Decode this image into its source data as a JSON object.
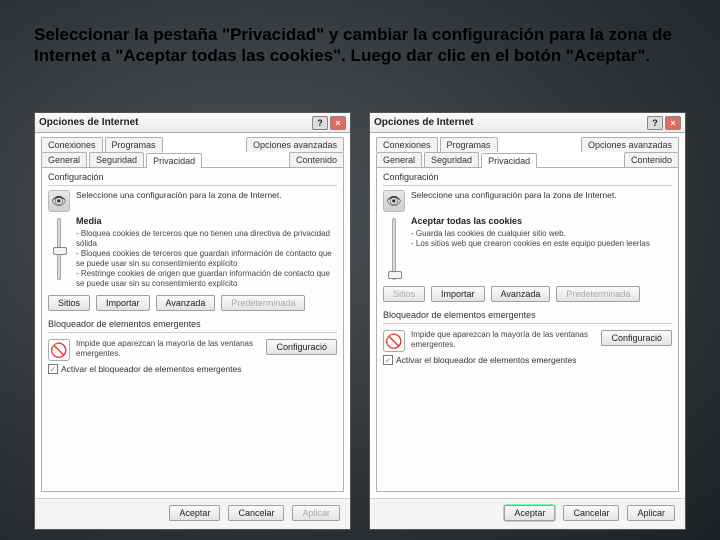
{
  "instruction": "Seleccionar la pestaña \"Privacidad\" y cambiar la configuración para la zona de Internet a \"Aceptar todas las cookies\". Luego dar clic en el botón \"Aceptar\".",
  "window_title": "Opciones de Internet",
  "tabs_row1": [
    "Conexiones",
    "Programas",
    "Opciones avanzadas"
  ],
  "tabs_row2": [
    "General",
    "Seguridad",
    "Privacidad",
    "Contenido"
  ],
  "active_tab": "Privacidad",
  "group_config": "Configuración",
  "config_text": "Seleccione una configuración para la zona de Internet.",
  "left": {
    "level_title": "Media",
    "level_desc": "- Bloquea cookies de terceros que no tienen una directiva de privacidad sólida\n- Bloquea cookies de terceros que guardan información de contacto que se puede usar sin su consentimiento explícito\n- Restringe cookies de origen que guardan información de contacto que se puede usar sin su consentimiento explícito"
  },
  "right": {
    "level_title": "Aceptar todas las cookies",
    "level_desc": "- Guarda las cookies de cualquier sitio web.\n- Los sitios web que crearon cookies en este equipo pueden leerlas"
  },
  "buttons": {
    "sitios": "Sitios",
    "importar": "Importar",
    "avanzada": "Avanzada",
    "predeterminada": "Predeterminada"
  },
  "group_popup": "Bloqueador de elementos emergentes",
  "popup_text": "Impide que aparezcan la mayoría de las ventanas emergentes.",
  "popup_config_btn": "Configuració",
  "popup_checkbox": "Activar el bloqueador de elementos emergentes",
  "footer": {
    "aceptar": "Aceptar",
    "cancelar": "Cancelar",
    "aplicar": "Aplicar"
  }
}
